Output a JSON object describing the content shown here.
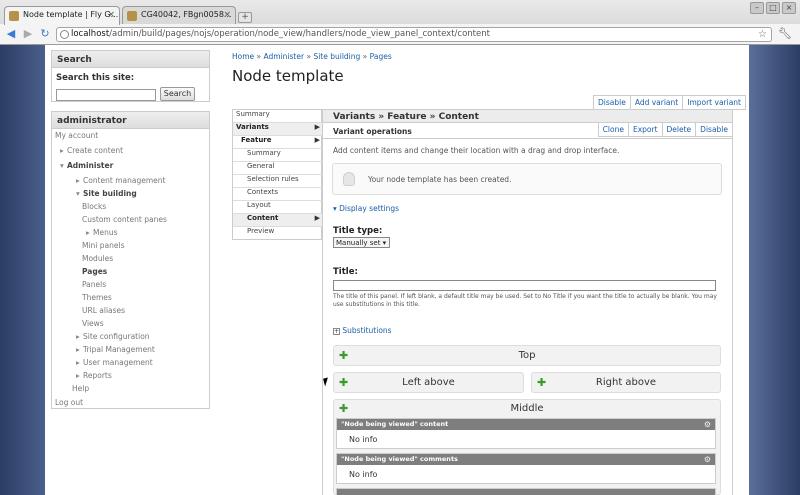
{
  "browser": {
    "tabs": [
      {
        "label": "Node template | Fly G..."
      },
      {
        "label": "CG40042, FBgn0058..."
      }
    ],
    "newtab": "+",
    "url_host": "localhost",
    "url_path": "/admin/build/pages/nojs/operation/node_view/handlers/node_view_panel_context/content"
  },
  "sidebar": {
    "search": {
      "block_title": "Search",
      "label": "Search this site:",
      "button": "Search"
    },
    "admin": {
      "block_title": "administrator",
      "items": [
        "My account",
        "Create content",
        "Administer",
        "Content management",
        "Site building",
        "Blocks",
        "Custom content panes",
        "Menus",
        "Mini panels",
        "Modules",
        "Pages",
        "Panels",
        "Themes",
        "URL aliases",
        "Views",
        "Site configuration",
        "Tripal Management",
        "User management",
        "Reports",
        "Help",
        "Log out"
      ]
    }
  },
  "breadcrumb": {
    "items": [
      "Home",
      "Administer",
      "Site building",
      "Pages"
    ],
    "sep": "»"
  },
  "page_title": "Node template",
  "top_actions": [
    "Disable",
    "Add variant",
    "Import variant"
  ],
  "left_nav": {
    "items": [
      "Summary",
      "Variants",
      "Feature",
      "Summary",
      "General",
      "Selection rules",
      "Contexts",
      "Layout",
      "Content",
      "Preview"
    ]
  },
  "variants_header": "Variants » Feature » Content",
  "variant_ops": {
    "label": "Variant operations",
    "buttons": [
      "Clone",
      "Export",
      "Delete",
      "Disable"
    ]
  },
  "intro": "Add content items and change their location with a drag and drop interface.",
  "message": "Your node template has been created.",
  "display_settings": "Display settings",
  "title_type": {
    "label": "Title type:",
    "value": "Manually set ▾"
  },
  "title_field": {
    "label": "Title:",
    "help": "The title of this panel. If left blank, a default title may be used. Set to No Title if you want the title to actually be blank. You may use substitutions in this title."
  },
  "substitutions": "Substitutions",
  "regions": [
    "Top",
    "Left above",
    "Right above",
    "Middle"
  ],
  "panes": [
    {
      "title": "\"Node being viewed\" content",
      "body": "No info"
    },
    {
      "title": "\"Node being viewed\" comments",
      "body": "No info"
    }
  ]
}
